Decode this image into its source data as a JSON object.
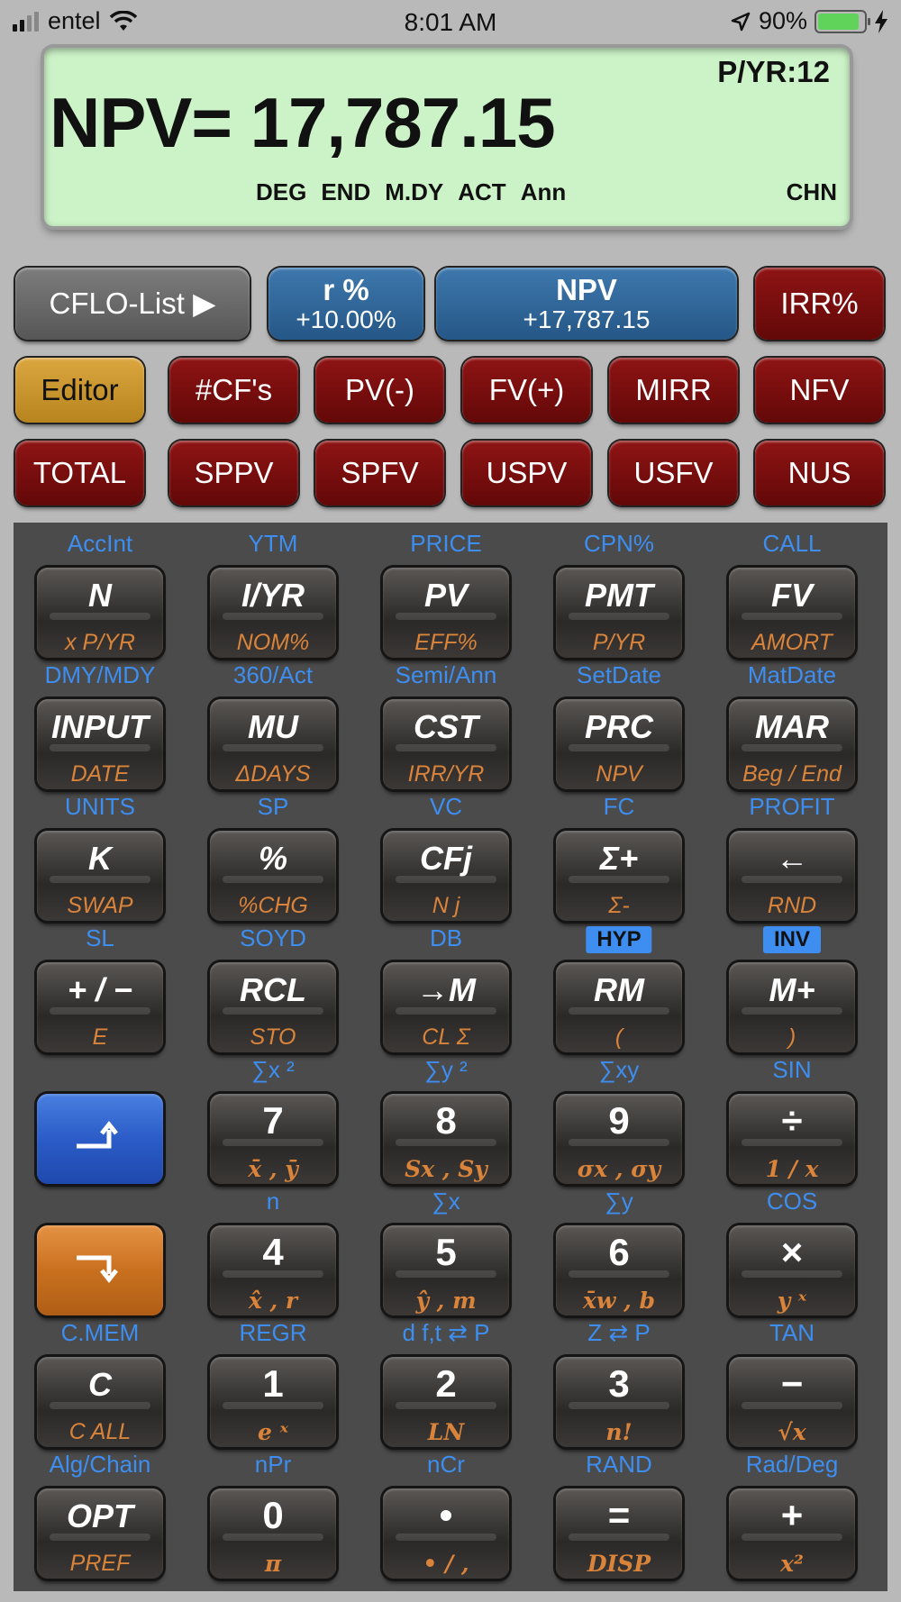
{
  "status_bar": {
    "carrier": "entel",
    "time": "8:01 AM",
    "battery": "90%",
    "battery_level": 0.9
  },
  "display": {
    "pyr": "P/YR:12",
    "main": "NPV= 17,787.15",
    "flags": [
      "DEG",
      "END",
      "M.DY",
      "ACT",
      "Ann"
    ],
    "mode": "CHN"
  },
  "softkeys": {
    "cflo_list": "CFLO-List ▶",
    "rate_label": "r %",
    "rate_value": "+10.00%",
    "npv_label": "NPV",
    "npv_value": "+17,787.15",
    "irr": "IRR%",
    "editor": "Editor",
    "cfs": "#CF's",
    "pv": "PV(-)",
    "fv": "FV(+)",
    "mirr": "MIRR",
    "nfv": "NFV",
    "total": "TOTAL",
    "sppv": "SPPV",
    "spfv": "SPFV",
    "uspv": "USPV",
    "usfv": "USFV",
    "nus": "NUS"
  },
  "keys": [
    [
      {
        "top": "AccInt",
        "main": "N",
        "sub": "x P/YR"
      },
      {
        "top": "YTM",
        "main": "I/YR",
        "sub": "NOM%"
      },
      {
        "top": "PRICE",
        "main": "PV",
        "sub": "EFF%"
      },
      {
        "top": "CPN%",
        "main": "PMT",
        "sub": "P/YR"
      },
      {
        "top": "CALL",
        "main": "FV",
        "sub": "AMORT"
      }
    ],
    [
      {
        "top": "DMY/MDY",
        "main": "INPUT",
        "sub": "DATE"
      },
      {
        "top": "360/Act",
        "main": "MU",
        "sub": "ΔDAYS"
      },
      {
        "top": "Semi/Ann",
        "main": "CST",
        "sub": "IRR/YR"
      },
      {
        "top": "SetDate",
        "main": "PRC",
        "sub": "NPV"
      },
      {
        "top": "MatDate",
        "main": "MAR",
        "sub": "Beg / End"
      }
    ],
    [
      {
        "top": "UNITS",
        "main": "K",
        "sub": "SWAP"
      },
      {
        "top": "SP",
        "main": "%",
        "sub": "%CHG"
      },
      {
        "top": "VC",
        "main": "CFj",
        "sub": "N j"
      },
      {
        "top": "FC",
        "main": "Σ+",
        "sub": "Σ-"
      },
      {
        "top": "PROFIT",
        "main": "←",
        "sub": "RND"
      }
    ],
    [
      {
        "top": "SL",
        "main": "+ / −",
        "sub": "E"
      },
      {
        "top": "SOYD",
        "main": "RCL",
        "sub": "STO"
      },
      {
        "top": "DB",
        "main": "→M",
        "sub": "CL Σ"
      },
      {
        "badge": "HYP",
        "main": "RM",
        "sub": "("
      },
      {
        "badge": "INV",
        "main": "M+",
        "sub": ")"
      }
    ],
    [
      {
        "top": "",
        "main": "",
        "sub": "",
        "special": "blue"
      },
      {
        "top": "∑x ²",
        "main": "7",
        "sub": "x̄ , ȳ",
        "num": true
      },
      {
        "top": "∑y ²",
        "main": "8",
        "sub": "Sx , Sy",
        "num": true
      },
      {
        "top": "∑xy",
        "main": "9",
        "sub": "σx , σy",
        "num": true
      },
      {
        "top": "SIN",
        "main": "÷",
        "sub": "1 / x",
        "num": true
      }
    ],
    [
      {
        "top": "",
        "main": "",
        "sub": "",
        "special": "orange"
      },
      {
        "top": "n",
        "main": "4",
        "sub": "x̂ , r",
        "num": true
      },
      {
        "top": "∑x",
        "main": "5",
        "sub": "ŷ , m",
        "num": true
      },
      {
        "top": "∑y",
        "main": "6",
        "sub": "x̄w , b",
        "num": true
      },
      {
        "top": "COS",
        "main": "×",
        "sub": "y ˣ",
        "num": true
      }
    ],
    [
      {
        "top": "C.MEM",
        "main": "C",
        "sub": "C ALL"
      },
      {
        "top": "REGR",
        "main": "1",
        "sub": "e ˣ",
        "num": true
      },
      {
        "top": "d f,t ⇄ P",
        "main": "2",
        "sub": "LN",
        "num": true
      },
      {
        "top": "Z ⇄ P",
        "main": "3",
        "sub": "n!",
        "num": true
      },
      {
        "top": "TAN",
        "main": "−",
        "sub": "√x",
        "num": true
      }
    ],
    [
      {
        "top": "Alg/Chain",
        "main": "OPT",
        "sub": "PREF"
      },
      {
        "top": "nPr",
        "main": "0",
        "sub": "π",
        "num": true
      },
      {
        "top": "nCr",
        "main": "•",
        "sub": "• / ,",
        "num": true
      },
      {
        "top": "RAND",
        "main": "=",
        "sub": "DISP",
        "num": true
      },
      {
        "top": "Rad/Deg",
        "main": "+",
        "sub": "x²",
        "num": true
      }
    ]
  ]
}
